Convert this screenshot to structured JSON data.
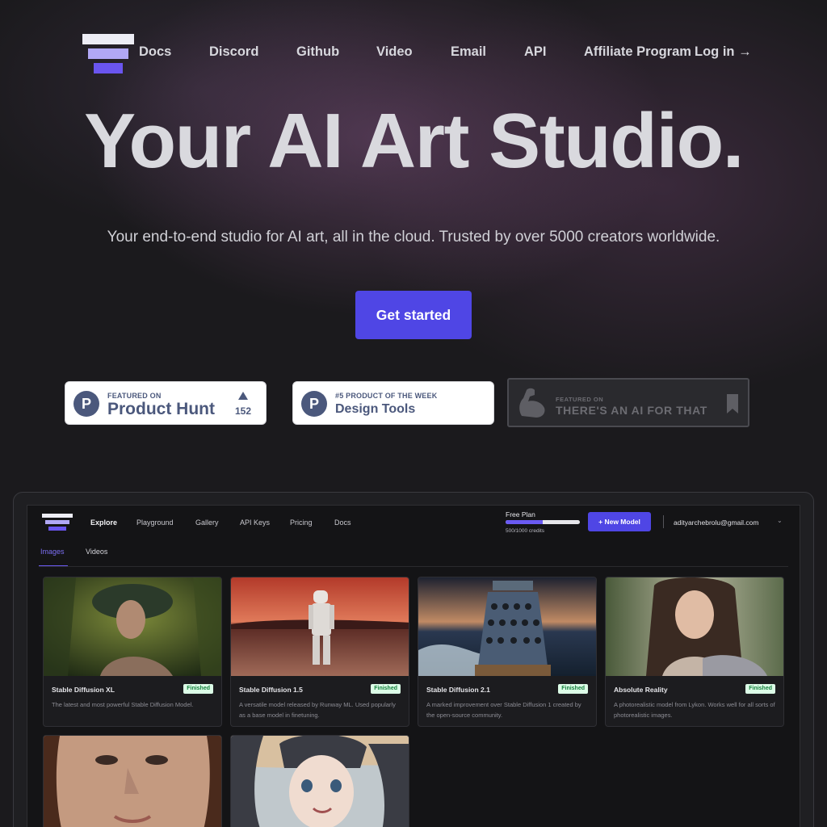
{
  "nav": {
    "links": [
      "Docs",
      "Discord",
      "Github",
      "Video",
      "Email",
      "API",
      "Affiliate Program"
    ],
    "login": "Log in →"
  },
  "hero": {
    "title": "Your AI Art Studio.",
    "subtitle": "Your end-to-end studio for AI art, all in the cloud. Trusted by over 5000 creators worldwide.",
    "cta": "Get started"
  },
  "badges": {
    "product_hunt": {
      "small": "FEATURED ON",
      "big": "Product Hunt",
      "votes": "152",
      "icon_letter": "P"
    },
    "product_week": {
      "small": "#5 PRODUCT OF THE WEEK",
      "big": "Design Tools",
      "icon_letter": "P"
    },
    "ai_for_that": {
      "small": "FEATURED ON",
      "big": "THERE'S AN AI FOR THAT"
    }
  },
  "app": {
    "nav": [
      "Explore",
      "Playground",
      "Gallery",
      "API Keys",
      "Pricing",
      "Docs"
    ],
    "plan": {
      "label": "Free Plan",
      "credits": "500/1000 credits",
      "used_fraction": 0.5
    },
    "new_model": "+ New Model",
    "user_email": "adityarchebrolu@gmail.com",
    "tabs": [
      "Images",
      "Videos"
    ],
    "cards": [
      {
        "name": "Stable Diffusion XL",
        "status": "Finished",
        "desc": "The latest and most powerful Stable Diffusion Model."
      },
      {
        "name": "Stable Diffusion 1.5",
        "status": "Finished",
        "desc": "A versatile model released by Runway ML. Used popularly as a base model in finetuning."
      },
      {
        "name": "Stable Diffusion 2.1",
        "status": "Finished",
        "desc": "A marked improvement over Stable Diffusion 1 created by the open-source community."
      },
      {
        "name": "Absolute Reality",
        "status": "Finished",
        "desc": "A photorealistic model from Lykon. Works well for all sorts of photorealistic images."
      }
    ]
  },
  "colors": {
    "accent": "#4f46e5",
    "background": "#1b1a1d",
    "status_bg": "#dcfce7",
    "status_text": "#15803d"
  }
}
